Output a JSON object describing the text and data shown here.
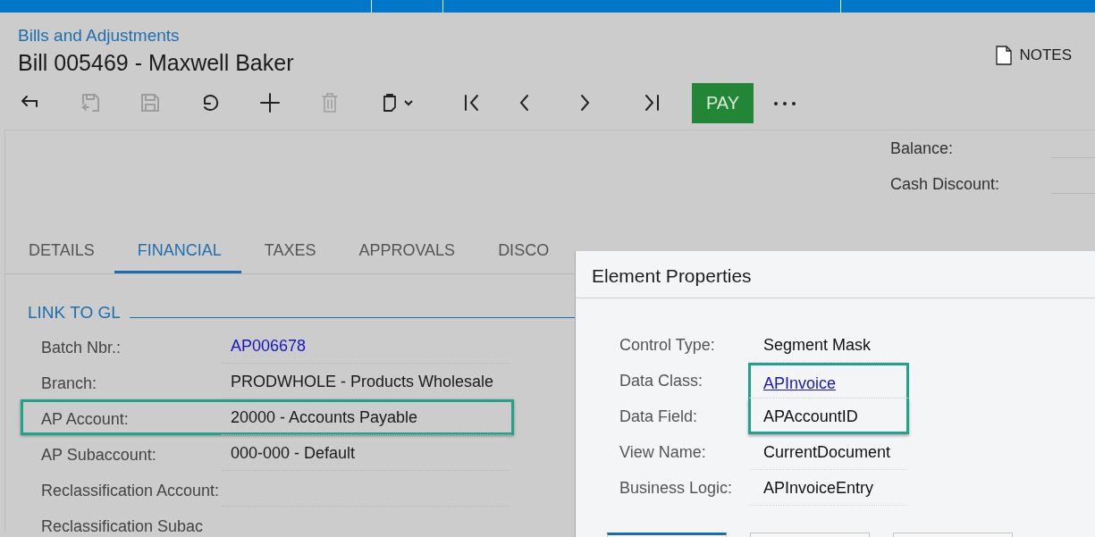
{
  "breadcrumb": "Bills and Adjustments",
  "title": "Bill 005469 - Maxwell Baker",
  "notes": "NOTES",
  "toolbar_buttons": [
    {
      "disabled": false
    },
    {
      "disabled": true
    },
    {
      "disabled": true
    },
    {
      "disabled": false
    },
    {
      "disabled": false
    },
    {
      "disabled": true
    },
    {
      "disabled": false
    },
    {
      "disabled": false
    },
    {
      "disabled": false
    },
    {
      "disabled": false
    },
    {
      "disabled": false
    }
  ],
  "pay_button": "PAY",
  "summary": [
    {
      "label": "Balance:"
    },
    {
      "label": "Cash Discount:"
    }
  ],
  "tabs": [
    {
      "label": "DETAILS",
      "selected": false
    },
    {
      "label": "FINANCIAL",
      "selected": true
    },
    {
      "label": "TAXES",
      "selected": false
    },
    {
      "label": "APPROVALS",
      "selected": false
    },
    {
      "label": "DISCO",
      "selected": false
    }
  ],
  "section": "LINK TO GL",
  "fields": [
    {
      "label": "Batch Nbr.:",
      "value": "AP006678",
      "kind": "link",
      "highlighted": false
    },
    {
      "label": "Branch:",
      "value": "PRODWHOLE - Products Wholesale",
      "kind": "text",
      "highlighted": false
    },
    {
      "label": "AP Account:",
      "value": "20000 - Accounts Payable",
      "kind": "text",
      "highlighted": true
    },
    {
      "label": "AP Subaccount:",
      "value": "000-000 - Default",
      "kind": "text",
      "highlighted": false
    },
    {
      "label": "Reclassification Account:",
      "highlighted": false
    },
    {
      "label": "Reclassification Subac",
      "highlighted": false
    }
  ],
  "dialog": {
    "title": "Element Properties",
    "rows": [
      {
        "label": "Control Type:",
        "value": "Segment Mask",
        "kind": "text",
        "highlighted": false
      },
      {
        "label": "Data Class:",
        "value": "APInvoice",
        "kind": "link",
        "highlighted": true
      },
      {
        "label": "Data Field:",
        "value": "APAccountID",
        "kind": "text",
        "highlighted": true
      },
      {
        "label": "View Name:",
        "value": "CurrentDocument",
        "kind": "text",
        "highlighted": false
      },
      {
        "label": "Business Logic:",
        "value": "APInvoiceEntry",
        "kind": "text",
        "highlighted": false
      }
    ]
  }
}
